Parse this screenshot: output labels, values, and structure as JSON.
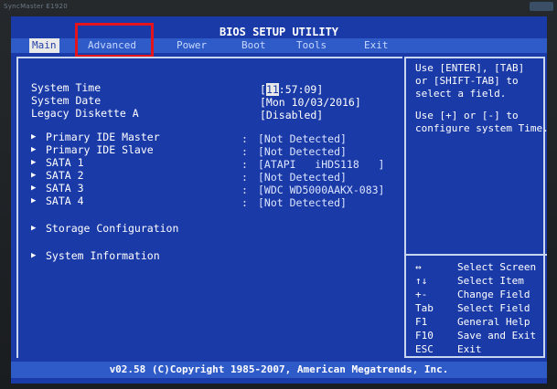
{
  "monitor": {
    "brand": "SyncMaster E1920"
  },
  "title": "BIOS SETUP UTILITY",
  "menu": {
    "tabs": [
      {
        "label": "Main",
        "active": true
      },
      {
        "label": "Advanced",
        "active": false
      },
      {
        "label": "Power",
        "active": false
      },
      {
        "label": "Boot",
        "active": false
      },
      {
        "label": "Tools",
        "active": false
      },
      {
        "label": "Exit",
        "active": false
      }
    ]
  },
  "main": {
    "system_time": {
      "label": "System Time",
      "value_cursor": "11",
      "value_rest": ":57:09]",
      "value_open": "["
    },
    "system_date": {
      "label": "System Date",
      "value": "[Mon 10/03/2016]"
    },
    "legacy_diskette": {
      "label": "Legacy Diskette A",
      "value": "[Disabled]"
    },
    "drives": [
      {
        "label": "Primary IDE Master",
        "value": "[Not Detected]"
      },
      {
        "label": "Primary IDE Slave",
        "value": "[Not Detected]"
      },
      {
        "label": "SATA 1",
        "value": "[ATAPI   iHDS118   ]"
      },
      {
        "label": "SATA 2",
        "value": "[Not Detected]"
      },
      {
        "label": "SATA 3",
        "value": "[WDC WD5000AAKX-083]"
      },
      {
        "label": "SATA 4",
        "value": "[Not Detected]"
      }
    ],
    "separator": ":",
    "storage_configuration": "Storage Configuration",
    "system_information": "System Information"
  },
  "help": {
    "line1": "Use [ENTER], [TAB]",
    "line2": "or [SHIFT-TAB] to",
    "line3": "select a field.",
    "line4": "Use [+] or [-] to",
    "line5": "configure system Time.",
    "keys": [
      {
        "key": "↔",
        "desc": "Select Screen"
      },
      {
        "key": "↑↓",
        "desc": "Select Item"
      },
      {
        "key": "+-",
        "desc": "Change Field"
      },
      {
        "key": "Tab",
        "desc": "Select Field"
      },
      {
        "key": "F1",
        "desc": "General Help"
      },
      {
        "key": "F10",
        "desc": "Save and Exit"
      },
      {
        "key": "ESC",
        "desc": "Exit"
      }
    ]
  },
  "footer": "v02.58 (C)Copyright 1985-2007, American Megatrends, Inc.",
  "colors": {
    "background": "#1a3aa8",
    "bar": "#2f5bc8",
    "highlight_box": "#e3141c",
    "active_tab": "#e9e9e9"
  }
}
